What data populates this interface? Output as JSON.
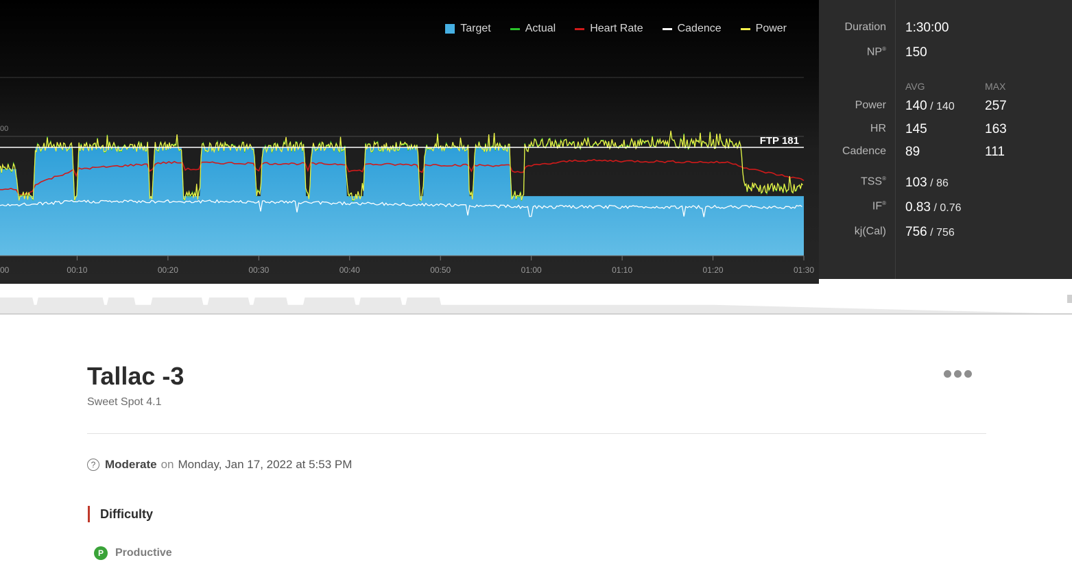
{
  "legend": {
    "target": "Target",
    "actual": "Actual",
    "heart_rate": "Heart Rate",
    "cadence": "Cadence",
    "power": "Power"
  },
  "chart": {
    "ftp_label": "FTP 181",
    "partial_y_tick": "00",
    "x_ticks": [
      "00",
      "00:10",
      "00:20",
      "00:30",
      "00:40",
      "00:50",
      "01:00",
      "01:10",
      "01:20",
      "01:30"
    ]
  },
  "chart_data": {
    "type": "area",
    "x_unit": "minutes",
    "x_range": [
      0,
      90
    ],
    "ftp": 181,
    "series": [
      {
        "name": "Target",
        "points": [
          [
            0,
            0.55
          ],
          [
            1.5,
            0.8
          ],
          [
            3.3,
            0.8
          ],
          [
            3.5,
            0.55
          ],
          [
            5.2,
            0.55
          ],
          [
            5.4,
            1.0
          ],
          [
            9.5,
            1.0
          ],
          [
            9.7,
            0.55
          ],
          [
            10,
            0.55
          ],
          [
            10.2,
            1.0
          ],
          [
            17.8,
            1.0
          ],
          [
            18,
            0.55
          ],
          [
            18.3,
            0.55
          ],
          [
            18.5,
            1.0
          ],
          [
            21.5,
            1.0
          ],
          [
            21.7,
            0.55
          ],
          [
            23.5,
            0.55
          ],
          [
            23.7,
            1.0
          ],
          [
            29.5,
            1.0
          ],
          [
            29.7,
            0.55
          ],
          [
            30.2,
            0.55
          ],
          [
            30.4,
            1.0
          ],
          [
            35,
            1.0
          ],
          [
            35.2,
            0.55
          ],
          [
            35.6,
            0.55
          ],
          [
            35.8,
            1.0
          ],
          [
            39.5,
            1.0
          ],
          [
            39.7,
            0.55
          ],
          [
            41.5,
            0.55
          ],
          [
            41.7,
            1.0
          ],
          [
            47.5,
            1.0
          ],
          [
            47.7,
            0.55
          ],
          [
            48.1,
            0.55
          ],
          [
            48.3,
            1.0
          ],
          [
            53,
            1.0
          ],
          [
            53.2,
            0.55
          ],
          [
            53.6,
            0.55
          ],
          [
            53.8,
            1.0
          ],
          [
            57.6,
            1.0
          ],
          [
            57.8,
            0.55
          ],
          [
            58.9,
            0.55
          ],
          [
            59,
            0.55
          ],
          [
            59.2,
            0.55
          ],
          [
            90,
            0.55
          ]
        ]
      },
      {
        "name": "Power",
        "approx_level": [
          [
            0,
            0.55
          ],
          [
            5,
            0.8
          ],
          [
            10,
            1.0
          ],
          [
            60,
            1.0
          ],
          [
            60.2,
            1.03
          ],
          [
            83,
            1.03
          ],
          [
            83.5,
            0.62
          ],
          [
            90,
            0.62
          ]
        ]
      },
      {
        "name": "Heart Rate",
        "approx_level": [
          [
            0,
            0.6
          ],
          [
            4,
            0.62
          ],
          [
            10,
            0.8
          ],
          [
            20,
            0.86
          ],
          [
            60,
            0.83
          ],
          [
            65,
            0.88
          ],
          [
            82,
            0.86
          ],
          [
            84,
            0.8
          ],
          [
            90,
            0.7
          ]
        ]
      },
      {
        "name": "Cadence",
        "approx_level": [
          [
            0,
            0.45
          ],
          [
            10,
            0.5
          ],
          [
            30,
            0.5
          ],
          [
            60,
            0.45
          ],
          [
            90,
            0.45
          ]
        ]
      },
      {
        "name": "Actual",
        "note": "nearly identical to Power"
      }
    ]
  },
  "stats": {
    "duration_label": "Duration",
    "duration": "1:30:00",
    "np_label": "NP",
    "np": "150",
    "avg_header": "AVG",
    "max_header": "MAX",
    "power_label": "Power",
    "power_avg_main": "140",
    "power_avg_sub": "140",
    "power_max": "257",
    "hr_label": "HR",
    "hr_avg": "145",
    "hr_max": "163",
    "cadence_label": "Cadence",
    "cadence_avg": "89",
    "cadence_max": "111",
    "tss_label": "TSS",
    "tss_main": "103",
    "tss_sub": "86",
    "if_label": "IF",
    "if_main": "0.83",
    "if_sub": "0.76",
    "kj_label": "kj(Cal)",
    "kj_main": "756",
    "kj_sub": "756",
    "registered_mark": "®",
    "slash": "/"
  },
  "workout": {
    "title": "Tallac -3",
    "subtitle": "Sweet Spot 4.1",
    "help_glyph": "?",
    "level": "Moderate",
    "on_word": "on",
    "date": "Monday, Jan 17, 2022 at 5:53 PM",
    "difficulty_heading": "Difficulty",
    "productive_letter": "P",
    "productive_label": "Productive"
  },
  "colors": {
    "target": "#46b0e3",
    "actual": "#29c229",
    "heart_rate": "#d11a1a",
    "cadence": "#ffffff",
    "power": "#f5f04a"
  }
}
